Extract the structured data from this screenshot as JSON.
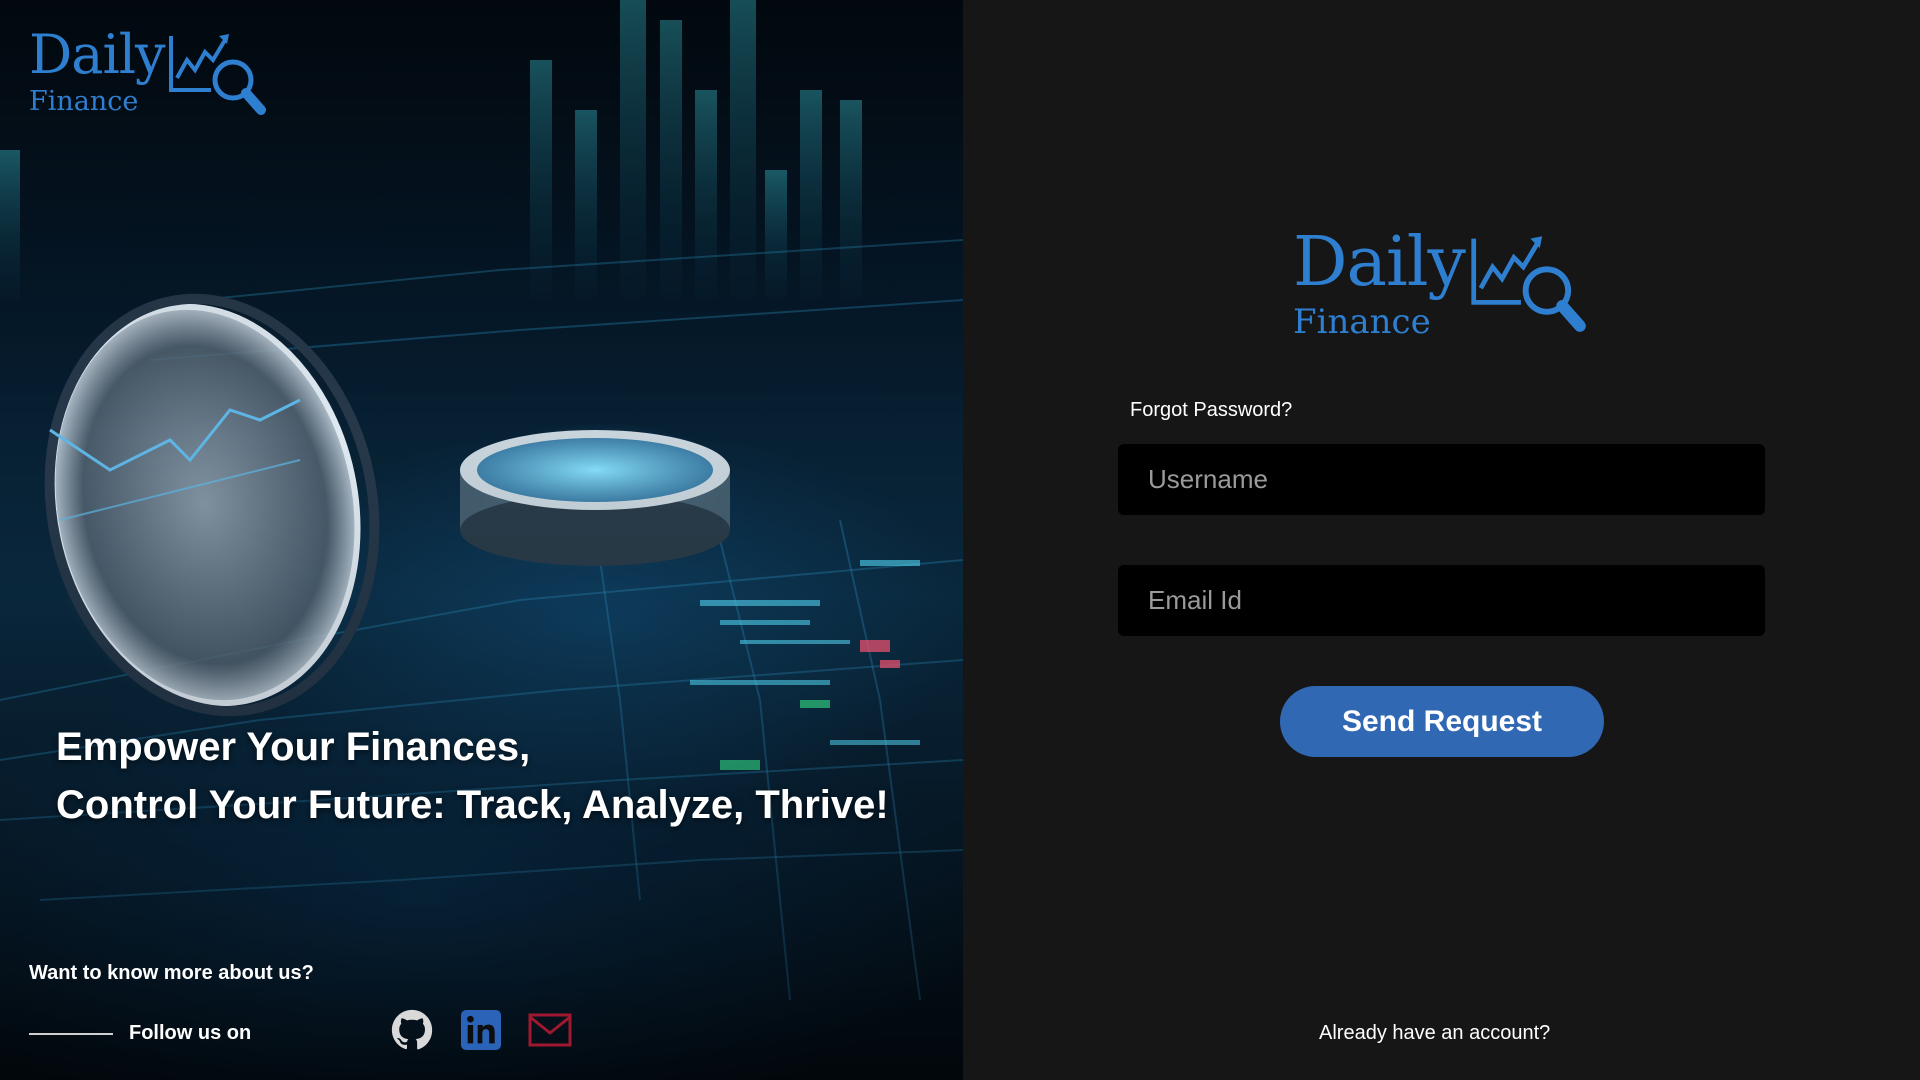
{
  "brand": {
    "name_line1": "Daily",
    "name_line2": "Finance",
    "logo_icon": "chart-magnifier-icon",
    "color": "#2f7fd1"
  },
  "hero": {
    "tagline_line1": "Empower Your Finances,",
    "tagline_line2": "Control Your Future: Track, Analyze, Thrive!",
    "know_more": "Want to know more about us?",
    "follow_label": "Follow us on",
    "social": [
      {
        "name": "github",
        "icon": "github-icon",
        "color": "#d9d9d9"
      },
      {
        "name": "linkedin",
        "icon": "linkedin-icon",
        "color": "#2a63b8"
      },
      {
        "name": "email",
        "icon": "mail-icon",
        "color": "#a0182f"
      }
    ]
  },
  "form": {
    "title": "Forgot Password?",
    "username_placeholder": "Username",
    "email_placeholder": "Email Id",
    "submit_label": "Send Request",
    "login_link": "Already have an account?"
  },
  "colors": {
    "panel_bg": "#161616",
    "field_bg": "#000000",
    "button_bg": "#3068b4"
  }
}
